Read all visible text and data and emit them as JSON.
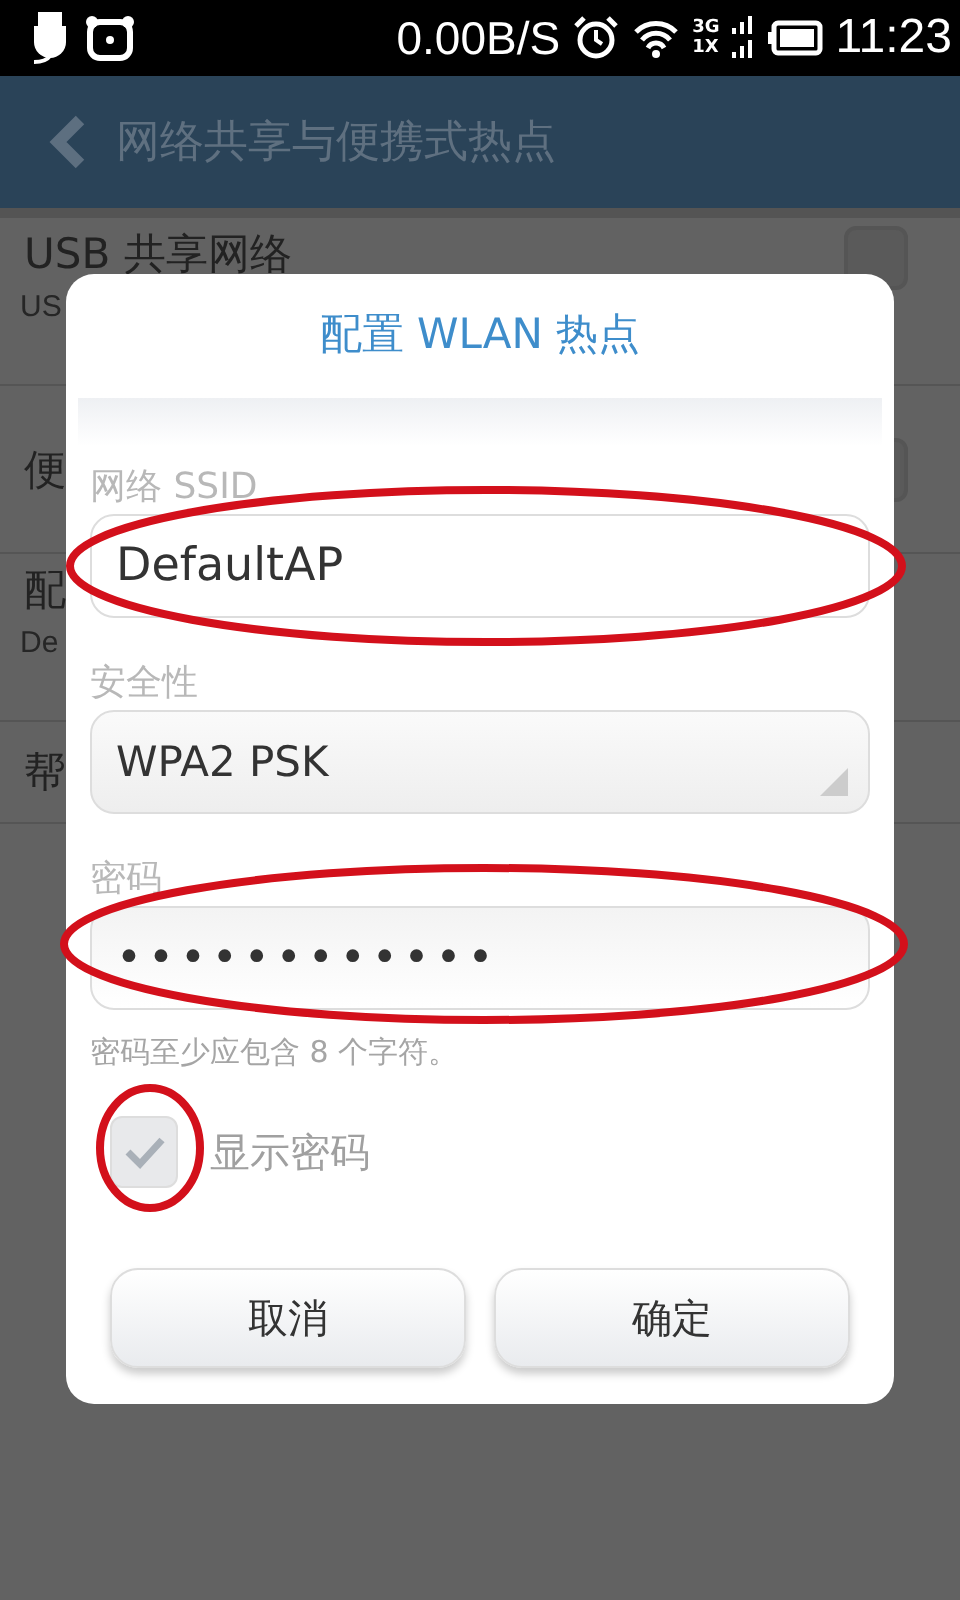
{
  "status_bar": {
    "speed": "0.00B/S",
    "network_types": [
      "3G",
      "1X"
    ],
    "time": "11:23"
  },
  "action_bar": {
    "title": "网络共享与便携式热点"
  },
  "settings_list": [
    {
      "kind": "checkbox",
      "title": "USB 共享网络",
      "subtitle": "US"
    },
    {
      "kind": "checkbox",
      "title": "便"
    },
    {
      "kind": "plain",
      "title": "配",
      "subtitle": "De"
    },
    {
      "kind": "plain",
      "title": "帮"
    }
  ],
  "dialog": {
    "title": "配置 WLAN 热点",
    "ssid": {
      "label": "网络 SSID",
      "value": "DefaultAP"
    },
    "security": {
      "label": "安全性",
      "value": "WPA2 PSK"
    },
    "password": {
      "label": "密码",
      "value": "••••••••••••",
      "hint": "密码至少应包含 8 个字符。"
    },
    "show_password": {
      "label": "显示密码",
      "checked": true
    },
    "buttons": [
      "取消",
      "确定"
    ]
  }
}
